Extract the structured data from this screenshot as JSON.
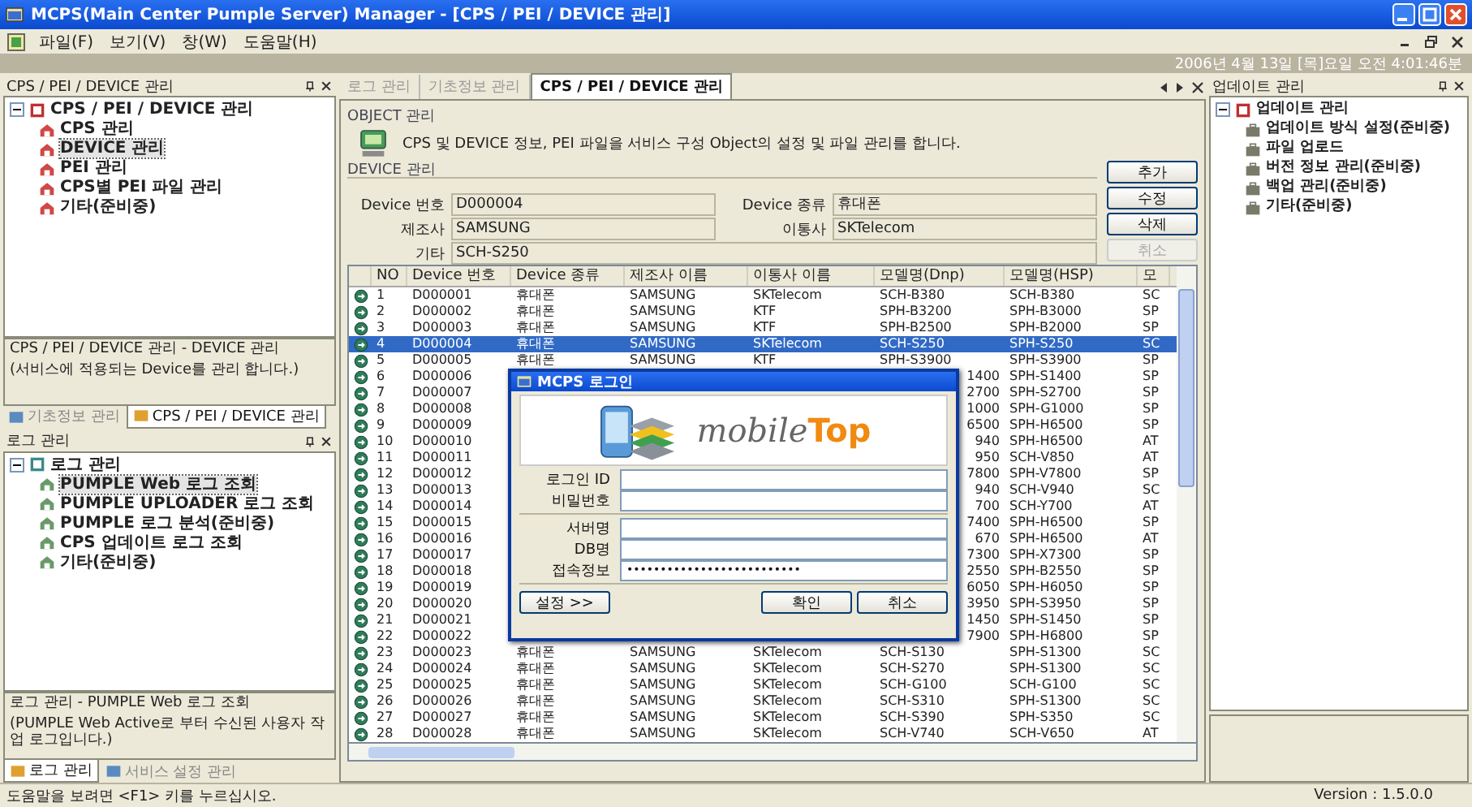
{
  "window": {
    "title": "MCPS(Main Center Pumple Server) Manager - [CPS / PEI / DEVICE 관리]"
  },
  "menu": [
    "파일(F)",
    "보기(V)",
    "창(W)",
    "도움말(H)"
  ],
  "datetime": "2006년 4월 13일 [목]요일   오전 4:01:46분",
  "left_panels": [
    {
      "title": "CPS / PEI / DEVICE 관리",
      "tree": {
        "label": "CPS / PEI / DEVICE 관리",
        "expanded": true,
        "children": [
          {
            "label": "CPS 관리",
            "selected": false
          },
          {
            "label": "DEVICE 관리",
            "selected": true
          },
          {
            "label": "PEI 관리",
            "selected": false
          },
          {
            "label": "CPS별 PEI 파일 관리",
            "selected": false
          },
          {
            "label": "기타(준비중)",
            "selected": false
          }
        ]
      },
      "description": {
        "title": "CPS / PEI / DEVICE 관리 - DEVICE 관리",
        "text": "(서비스에 적용되는 Device를 관리 합니다.)"
      },
      "tabs": [
        {
          "label": "기초정보 관리",
          "selected": false
        },
        {
          "label": "CPS / PEI / DEVICE 관리",
          "selected": true
        }
      ]
    },
    {
      "title": "로그 관리",
      "tree": {
        "label": "로그 관리",
        "expanded": true,
        "children": [
          {
            "label": "PUMPLE Web 로그 조회",
            "selected": true
          },
          {
            "label": "PUMPLE UPLOADER 로그 조회",
            "selected": false
          },
          {
            "label": "PUMPLE 로그 분석(준비중)",
            "selected": false
          },
          {
            "label": "CPS 업데이트 로그 조회",
            "selected": false
          },
          {
            "label": "기타(준비중)",
            "selected": false
          }
        ]
      },
      "description": {
        "title": "로그 관리 - PUMPLE Web 로그 조회",
        "text": "(PUMPLE Web Active로 부터 수신된 사용자 작업 로그입니다.)"
      },
      "tabs": [
        {
          "label": "로그 관리",
          "selected": true
        },
        {
          "label": "서비스 설정 관리",
          "selected": false
        }
      ]
    }
  ],
  "center": {
    "tabs": [
      {
        "label": "로그 관리",
        "selected": false
      },
      {
        "label": "기초정보 관리",
        "selected": false
      },
      {
        "label": "CPS / PEI / DEVICE 관리",
        "selected": true
      }
    ],
    "object_section": {
      "title": "OBJECT 관리",
      "text": "CPS 및 DEVICE 정보, PEI 파일을 서비스 구성 Object의 설정 및 파일 관리를 합니다."
    },
    "device_section": {
      "title": "DEVICE 관리",
      "fields": [
        {
          "label": "Device 번호",
          "value": "D000004"
        },
        {
          "label": "Device 종류",
          "value": "휴대폰"
        },
        {
          "label": "제조사",
          "value": "SAMSUNG"
        },
        {
          "label": "이통사",
          "value": "SKTelecom"
        },
        {
          "label": "기타",
          "value": "SCH-S250"
        }
      ],
      "buttons": [
        {
          "label": "추가",
          "disabled": false
        },
        {
          "label": "수정",
          "disabled": false
        },
        {
          "label": "삭제",
          "disabled": false
        },
        {
          "label": "취소",
          "disabled": true
        }
      ]
    },
    "table": {
      "columns": [
        "NO",
        "Device 번호",
        "Device 종류",
        "제조사 이름",
        "이통사 이름",
        "모델명(Dnp)",
        "모델명(HSP)",
        "모"
      ],
      "rows": [
        {
          "selected": false,
          "no": "1",
          "device_no": "D000001",
          "device_type": "휴대폰",
          "maker": "SAMSUNG",
          "carrier": "SKTelecom",
          "model_dnp": "SCH-B380",
          "model_hsp": "SCH-B380",
          "column_8": "SC"
        },
        {
          "selected": false,
          "no": "2",
          "device_no": "D000002",
          "device_type": "휴대폰",
          "maker": "SAMSUNG",
          "carrier": "KTF",
          "model_dnp": "SPH-B3200",
          "model_hsp": "SPH-B3000",
          "column_8": "SP"
        },
        {
          "selected": false,
          "no": "3",
          "device_no": "D000003",
          "device_type": "휴대폰",
          "maker": "SAMSUNG",
          "carrier": "KTF",
          "model_dnp": "SPH-B2500",
          "model_hsp": "SPH-B2000",
          "column_8": "SP"
        },
        {
          "selected": true,
          "no": "4",
          "device_no": "D000004",
          "device_type": "휴대폰",
          "maker": "SAMSUNG",
          "carrier": "SKTelecom",
          "model_dnp": "SCH-S250",
          "model_hsp": "SPH-S250",
          "column_8": "SC"
        },
        {
          "selected": false,
          "no": "5",
          "device_no": "D000005",
          "device_type": "휴대폰",
          "maker": "SAMSUNG",
          "carrier": "KTF",
          "model_dnp": "SPH-S3900",
          "model_hsp": "SPH-S3900",
          "column_8": "SP"
        },
        {
          "selected": false,
          "no": "6",
          "device_no": "D000006",
          "model_dnp": "1400",
          "model_hsp": "SPH-S1400",
          "column_8": "SP"
        },
        {
          "selected": false,
          "no": "7",
          "device_no": "D000007",
          "model_dnp": "2700",
          "model_hsp": "SPH-S2700",
          "column_8": "SP"
        },
        {
          "selected": false,
          "no": "8",
          "device_no": "D000008",
          "model_dnp": "1000",
          "model_hsp": "SPH-G1000",
          "column_8": "SP"
        },
        {
          "selected": false,
          "no": "9",
          "device_no": "D000009",
          "model_dnp": "6500",
          "model_hsp": "SPH-H6500",
          "column_8": "SP"
        },
        {
          "selected": false,
          "no": "10",
          "device_no": "D000010",
          "model_dnp": "940",
          "model_hsp": "SPH-H6500",
          "column_8": "AT"
        },
        {
          "selected": false,
          "no": "11",
          "device_no": "D000011",
          "model_dnp": "950",
          "model_hsp": "SCH-V850",
          "column_8": "AT"
        },
        {
          "selected": false,
          "no": "12",
          "device_no": "D000012",
          "model_dnp": "7800",
          "model_hsp": "SPH-V7800",
          "column_8": "SP"
        },
        {
          "selected": false,
          "no": "13",
          "device_no": "D000013",
          "model_dnp": "940",
          "model_hsp": "SCH-V940",
          "column_8": "SC"
        },
        {
          "selected": false,
          "no": "14",
          "device_no": "D000014",
          "model_dnp": "700",
          "model_hsp": "SCH-Y700",
          "column_8": "AT"
        },
        {
          "selected": false,
          "no": "15",
          "device_no": "D000015",
          "model_dnp": "7400",
          "model_hsp": "SPH-H6500",
          "column_8": "SP"
        },
        {
          "selected": false,
          "no": "16",
          "device_no": "D000016",
          "model_dnp": "670",
          "model_hsp": "SPH-H6500",
          "column_8": "AT"
        },
        {
          "selected": false,
          "no": "17",
          "device_no": "D000017",
          "model_dnp": "7300",
          "model_hsp": "SPH-X7300",
          "column_8": "SP"
        },
        {
          "selected": false,
          "no": "18",
          "device_no": "D000018",
          "model_dnp": "2550",
          "model_hsp": "SPH-B2550",
          "column_8": "SP"
        },
        {
          "selected": false,
          "no": "19",
          "device_no": "D000019",
          "model_dnp": "6050",
          "model_hsp": "SPH-H6050",
          "column_8": "SP"
        },
        {
          "selected": false,
          "no": "20",
          "device_no": "D000020",
          "model_dnp": "3950",
          "model_hsp": "SPH-S3950",
          "column_8": "SP"
        },
        {
          "selected": false,
          "no": "21",
          "device_no": "D000021",
          "model_dnp": "1450",
          "model_hsp": "SPH-S1450",
          "column_8": "SP"
        },
        {
          "selected": false,
          "no": "22",
          "device_no": "D000022",
          "model_dnp": "7900",
          "model_hsp": "SPH-H6800",
          "column_8": "SP"
        },
        {
          "selected": false,
          "no": "23",
          "device_no": "D000023",
          "device_type": "휴대폰",
          "maker": "SAMSUNG",
          "carrier": "SKTelecom",
          "model_dnp": "SCH-S130",
          "model_hsp": "SPH-S1300",
          "column_8": "SC"
        },
        {
          "selected": false,
          "no": "24",
          "device_no": "D000024",
          "device_type": "휴대폰",
          "maker": "SAMSUNG",
          "carrier": "SKTelecom",
          "model_dnp": "SCH-S270",
          "model_hsp": "SPH-S1300",
          "column_8": "SC"
        },
        {
          "selected": false,
          "no": "25",
          "device_no": "D000025",
          "device_type": "휴대폰",
          "maker": "SAMSUNG",
          "carrier": "SKTelecom",
          "model_dnp": "SCH-G100",
          "model_hsp": "SCH-G100",
          "column_8": "SC"
        },
        {
          "selected": false,
          "no": "26",
          "device_no": "D000026",
          "device_type": "휴대폰",
          "maker": "SAMSUNG",
          "carrier": "SKTelecom",
          "model_dnp": "SCH-S310",
          "model_hsp": "SPH-S1300",
          "column_8": "SC"
        },
        {
          "selected": false,
          "no": "27",
          "device_no": "D000027",
          "device_type": "휴대폰",
          "maker": "SAMSUNG",
          "carrier": "SKTelecom",
          "model_dnp": "SCH-S390",
          "model_hsp": "SPH-S350",
          "column_8": "SC"
        },
        {
          "selected": false,
          "no": "28",
          "device_no": "D000028",
          "device_type": "휴대폰",
          "maker": "SAMSUNG",
          "carrier": "SKTelecom",
          "model_dnp": "SCH-V740",
          "model_hsp": "SCH-V650",
          "column_8": "AT"
        }
      ]
    }
  },
  "dialog": {
    "title": "MCPS 로그인",
    "logo_text": [
      "mobile",
      "Top"
    ],
    "field_groups": [
      [
        {
          "label": "로그인 ID"
        },
        {
          "label": "비밀번호"
        }
      ],
      [
        {
          "label": "서버명"
        },
        {
          "label": "DB명"
        },
        {
          "label": "접속정보",
          "value": "••••••••••••••••••••••••••"
        }
      ]
    ],
    "buttons": [
      "설정 >>",
      "확인",
      "취소"
    ]
  },
  "right_panel": {
    "title": "업데이트 관리",
    "tree": {
      "label": "업데이트 관리",
      "expanded": true,
      "children": [
        {
          "label": "업데이트 방식 설정(준비중)",
          "selected": false
        },
        {
          "label": "파일 업로드",
          "selected": false
        },
        {
          "label": "버전 정보 관리(준비중)",
          "selected": false
        },
        {
          "label": "백업 관리(준비중)",
          "selected": false
        },
        {
          "label": "기타(준비중)",
          "selected": false
        }
      ]
    }
  },
  "status_bar": {
    "help": "도움말을 보려면 <F1> 키를 누르십시오.",
    "version": "Version : 1.5.0.0"
  }
}
